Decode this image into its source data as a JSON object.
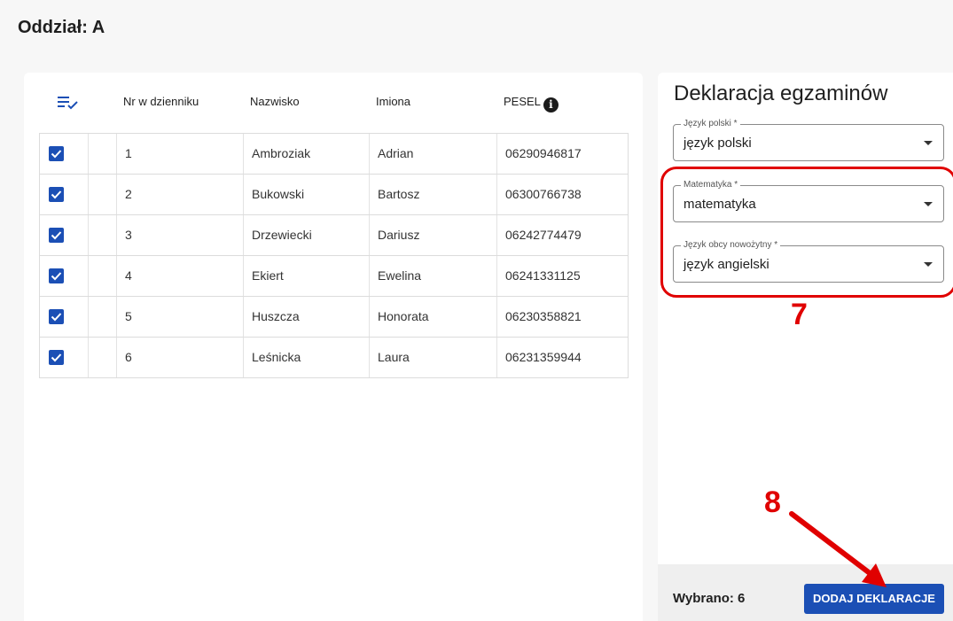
{
  "header": {
    "title": "Oddział: A"
  },
  "table": {
    "columns": [
      "Nr w dzienniku",
      "Nazwisko",
      "Imiona",
      "PESEL"
    ],
    "info_glyph": "i",
    "rows": [
      {
        "nr": "1",
        "nazwisko": "Ambroziak",
        "imiona": "Adrian",
        "pesel": "06290946817",
        "checked": true
      },
      {
        "nr": "2",
        "nazwisko": "Bukowski",
        "imiona": "Bartosz",
        "pesel": "06300766738",
        "checked": true
      },
      {
        "nr": "3",
        "nazwisko": "Drzewiecki",
        "imiona": "Dariusz",
        "pesel": "06242774479",
        "checked": true
      },
      {
        "nr": "4",
        "nazwisko": "Ekiert",
        "imiona": "Ewelina",
        "pesel": "06241331125",
        "checked": true
      },
      {
        "nr": "5",
        "nazwisko": "Huszcza",
        "imiona": "Honorata",
        "pesel": "06230358821",
        "checked": true
      },
      {
        "nr": "6",
        "nazwisko": "Leśnicka",
        "imiona": "Laura",
        "pesel": "06231359944",
        "checked": true
      }
    ]
  },
  "panel": {
    "title": "Deklaracja egzaminów",
    "fields": [
      {
        "label": "Język polski *",
        "value": "język polski"
      },
      {
        "label": "Matematyka *",
        "value": "matematyka"
      },
      {
        "label": "Język obcy nowożytny *",
        "value": "język angielski"
      }
    ],
    "selected_label": "Wybrano: 6",
    "add_button": "DODAJ DEKLARACJE"
  },
  "annotations": {
    "box_number": "7",
    "arrow_number": "8"
  },
  "colors": {
    "accent": "#1b4fb5",
    "annotation": "#e00000"
  }
}
